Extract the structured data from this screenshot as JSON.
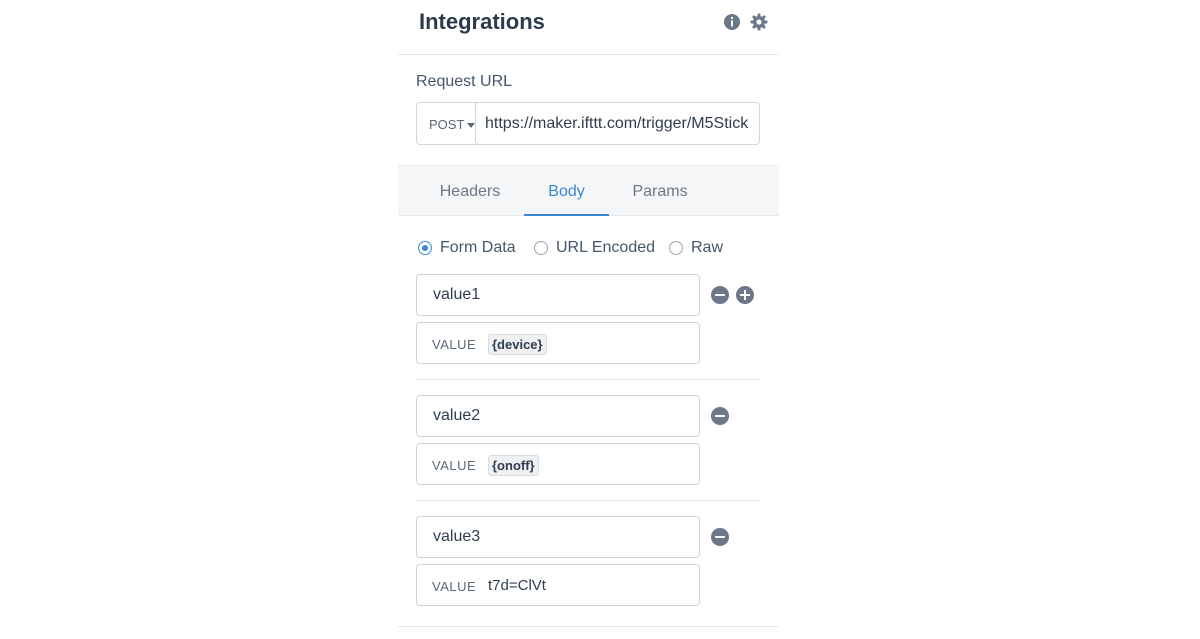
{
  "header": {
    "title": "Integrations",
    "icons": [
      "info-icon",
      "gear-icon"
    ]
  },
  "request": {
    "label": "Request URL",
    "method": "POST",
    "url": "https://maker.ifttt.com/trigger/M5Stick"
  },
  "tabs": [
    {
      "label": "Headers",
      "active": false
    },
    {
      "label": "Body",
      "active": true
    },
    {
      "label": "Params",
      "active": false
    }
  ],
  "body_type": {
    "options": [
      "Form Data",
      "URL Encoded",
      "Raw"
    ],
    "selected": "Form Data"
  },
  "params": [
    {
      "key": "value1",
      "value_label": "VALUE",
      "value": "{device}",
      "value_is_token": true
    },
    {
      "key": "value2",
      "value_label": "VALUE",
      "value": "{onoff}",
      "value_is_token": true
    },
    {
      "key": "value3",
      "value_label": "VALUE",
      "value": "t7d=ClVt",
      "value_is_token": false
    }
  ],
  "colors": {
    "accent": "#3a86d6",
    "title": "#2d3b4e",
    "icon": "#6b7888"
  }
}
